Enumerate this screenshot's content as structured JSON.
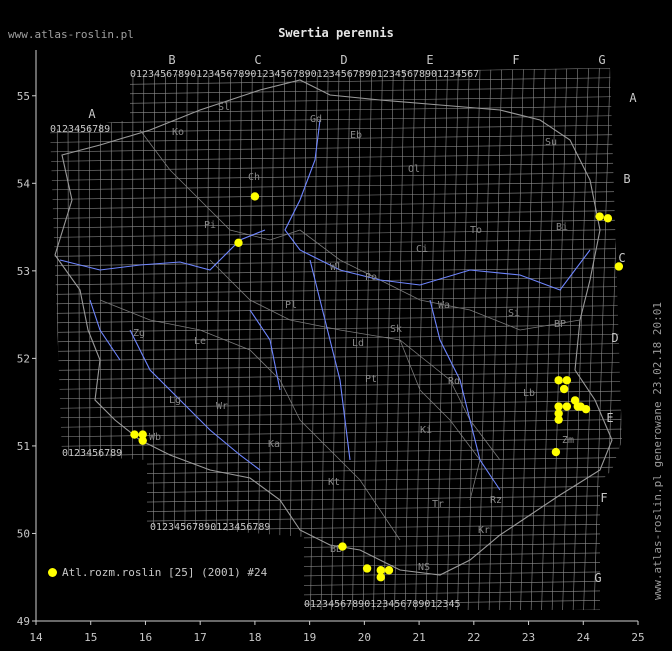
{
  "site_label": "www.atlas-roslin.pl",
  "title": "Swertia perennis",
  "side_note": "www.atlas-roslin.pl generowane 23.02.18 20:01",
  "legend": {
    "label": "Atl.rozm.roslin [25] (2001) #24",
    "marker_color": "#ffff00"
  },
  "colors": {
    "background": "#000000",
    "grid": "#8c8c8c",
    "river": "#6f86ff",
    "border": "#9a9a9a",
    "marker": "#ffff00"
  },
  "axes": {
    "x_ticks": [
      "14",
      "15",
      "16",
      "17",
      "18",
      "19",
      "20",
      "21",
      "22",
      "23",
      "24",
      "25"
    ],
    "y_ticks": [
      "49",
      "50",
      "51",
      "52",
      "53",
      "54",
      "55"
    ]
  },
  "grid": {
    "letters_top": [
      "A",
      "B",
      "C",
      "D",
      "E",
      "F",
      "G"
    ],
    "letters_right": [
      "A",
      "B",
      "C",
      "D",
      "E",
      "F",
      "G"
    ],
    "top_row_digits": "0123456789",
    "bottom_row_digits": "0123456789"
  },
  "region_labels": [
    "Sl",
    "Gd",
    "Eb",
    "Ol",
    "Su",
    "Ko",
    "Ch",
    "Pi",
    "To",
    "Bi",
    "Ci",
    "Wl",
    "Po",
    "Pl",
    "Ld",
    "Sk",
    "Wa",
    "Si",
    "BP",
    "Zg",
    "Le",
    "Rd",
    "Lb",
    "Lg",
    "Wr",
    "Pt",
    "Ki",
    "Wb",
    "Ka",
    "Kt",
    "Tr",
    "Rz",
    "Zm",
    "Kr",
    "NS",
    "BB"
  ],
  "chart_data": {
    "type": "scatter",
    "xlim": [
      14,
      25
    ],
    "ylim": [
      49,
      55.5
    ],
    "series": [
      {
        "x": [
          18.0,
          17.7,
          15.8,
          15.95,
          15.95,
          24.3,
          24.45,
          24.65,
          19.6,
          20.05,
          20.3,
          20.45,
          20.3,
          23.55,
          23.7,
          23.65,
          23.55,
          23.55,
          23.55,
          23.7,
          23.85,
          23.9,
          23.95,
          24.05,
          23.5
        ],
        "y": [
          53.85,
          53.32,
          51.13,
          51.13,
          51.06,
          53.62,
          53.6,
          53.05,
          49.85,
          49.6,
          49.58,
          49.58,
          49.5,
          51.75,
          51.75,
          51.65,
          51.45,
          51.37,
          51.3,
          51.45,
          51.52,
          51.45,
          51.45,
          51.42,
          50.93
        ]
      }
    ]
  }
}
